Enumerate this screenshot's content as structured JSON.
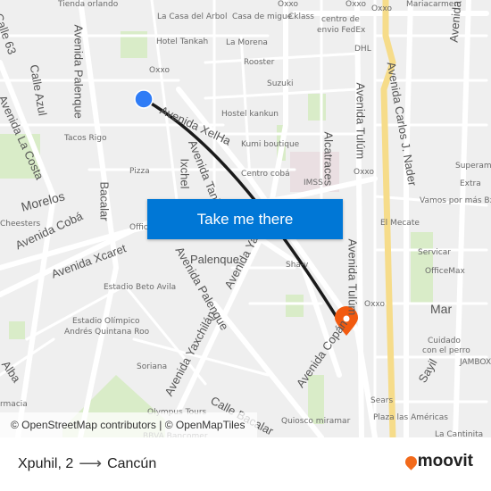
{
  "map": {
    "labels": [
      "Tienda orlando",
      "La Casa del Arbol",
      "Casa de migue",
      "Cklass",
      "centro de",
      "envio FedEx",
      "Oxxo",
      "Oxxo",
      "Oxxo",
      "Mariacarmen",
      "Hotel Tankah",
      "La Morena",
      "DHL",
      "Rooster",
      "Oxxo",
      "Suzuki",
      "Hostel kankun",
      "Tacos Rigo",
      "Kumi boutique",
      "Pizza",
      "Centro cobá",
      "Oxxo",
      "Superama",
      "IMSS",
      "Extra",
      "Vamos por más Bx+",
      "El Mecate",
      "Cheesters",
      "Offic",
      "Servicar",
      "OfficeMax",
      "Sha-v",
      "Estadio Beto Avila",
      "Oxxo",
      "Estadio Olímpico",
      "Andrés Quintana Roo",
      "Cuidado",
      "con el perro",
      "Soriana",
      "JAMBOX",
      "Sears",
      "Plaza las Américas",
      "La Cantinita",
      "Quiosco miramar",
      "Olympus Tours",
      "BBVA Bancomer",
      "rmacia"
    ],
    "roads": [
      "Calle 63",
      "Avenida Palenque",
      "Calle Azul",
      "Avenida La Costa",
      "Avenida XelHa",
      "Avenida Tankah",
      "Ixchel",
      "Bacalar",
      "Alcatraces",
      "Avenida Tulúm",
      "Avenida Carlos J. Nader",
      "Avenida Bonampak",
      "Morelos",
      "Avenida Cobá",
      "Avenida Xcaret",
      "Palenque",
      "Avenida Yaxchilán",
      "Avenida Tulúm",
      "Mar",
      "Avenida Yaxchilán",
      "Calle Bacalar",
      "Avenida Copán",
      "Sayil",
      "Alba",
      "Avenida Palenque"
    ],
    "origin_marker_color": "#2f7cf6",
    "destination_marker_color": "#f25a0f",
    "route_color": "#1a1a1a",
    "attribution": "© OpenStreetMap contributors | © OpenMapTiles"
  },
  "cta": {
    "label": "Take me there"
  },
  "footer": {
    "origin": "Xpuhil, 2",
    "arrow_icon": "arrow-right-icon",
    "destination": "Cancún",
    "logo": "moovit"
  }
}
